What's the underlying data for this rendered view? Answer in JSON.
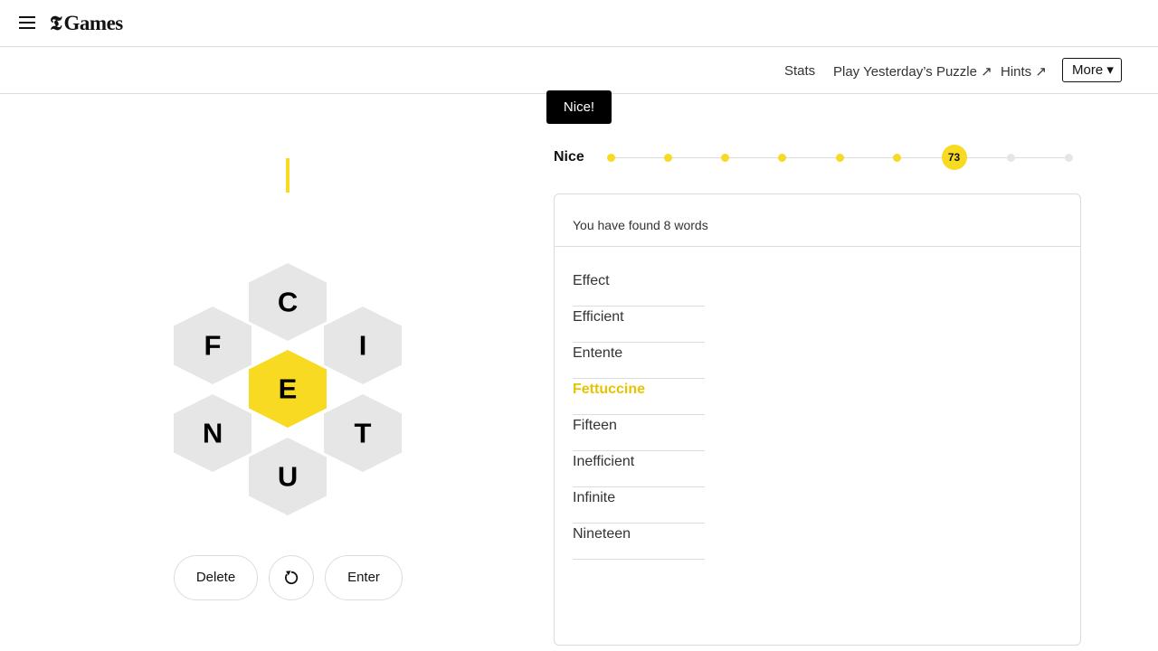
{
  "header": {
    "menu_icon": "hamburger-menu-icon",
    "logo_mark": "𝕿",
    "logo_text": "Games"
  },
  "nav": {
    "stats": "Stats",
    "yesterday": "Play Yesterday’s Puzzle ↗",
    "hints": "Hints ↗",
    "more": "More ▾"
  },
  "toast": "Nice!",
  "hive": {
    "center": "E",
    "top": "C",
    "upper_left": "F",
    "upper_right": "I",
    "lower_left": "N",
    "lower_right": "T",
    "bottom": "U"
  },
  "controls": {
    "delete": "Delete",
    "shuffle_icon": "shuffle-icon",
    "enter": "Enter"
  },
  "progress": {
    "rank": "Nice",
    "score": "73",
    "levels_total": 9,
    "current_level_index": 6
  },
  "wordlist": {
    "found_text": "You have found 8 words",
    "words": [
      {
        "text": "Effect",
        "pangram": false
      },
      {
        "text": "Efficient",
        "pangram": false
      },
      {
        "text": "Entente",
        "pangram": false
      },
      {
        "text": "Fettuccine",
        "pangram": true
      },
      {
        "text": "Fifteen",
        "pangram": false
      },
      {
        "text": "Inefficient",
        "pangram": false
      },
      {
        "text": "Infinite",
        "pangram": false
      },
      {
        "text": "Nineteen",
        "pangram": false
      }
    ]
  },
  "colors": {
    "accent": "#f7da21",
    "pangram": "#e8c300",
    "cell": "#e6e6e6"
  }
}
